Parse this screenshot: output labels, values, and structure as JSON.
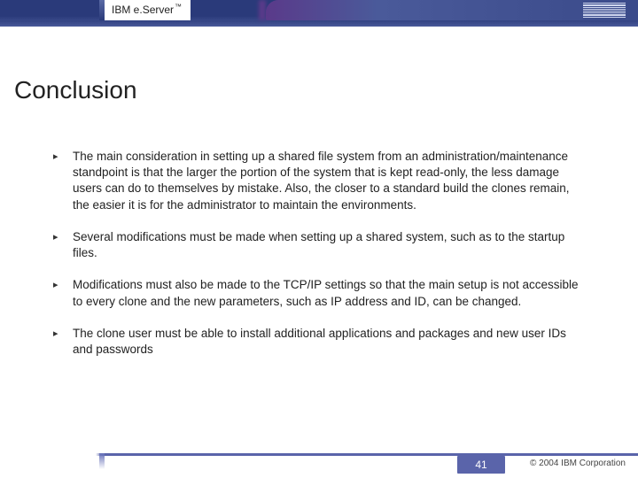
{
  "header": {
    "brand_prefix": "IBM e.",
    "brand_suffix": "Server",
    "tm": "™",
    "logo_name": "ibm-logo"
  },
  "title": "Conclusion",
  "bullets": [
    "The main consideration in setting up a shared file system from an administration/maintenance standpoint is that the larger the portion of the system that is kept read-only, the less damage users can do to themselves by mistake. Also, the closer to a standard build the clones remain, the easier it is for the administrator to maintain the environments.",
    "Several modifications must be made when setting up a shared system, such as to the startup files.",
    "Modifications must also be made to the TCP/IP settings so that the main setup is not accessible to every clone and the new parameters, such as IP address and ID, can be changed.",
    "The clone user must be able to install additional applications and packages and new user IDs and passwords"
  ],
  "footer": {
    "page": "41",
    "copyright": "© 2004 IBM Corporation"
  }
}
